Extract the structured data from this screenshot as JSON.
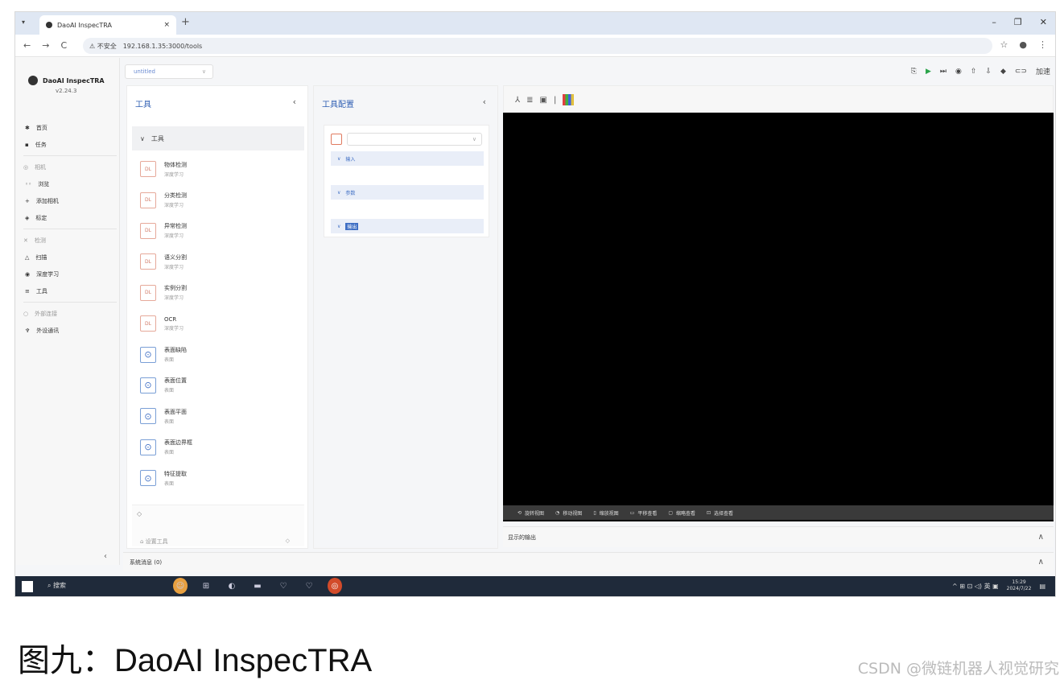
{
  "browser": {
    "tab_title": "DaoAI InspecTRA",
    "tab_close": "×",
    "new_tab": "+",
    "tabs_menu": "▾",
    "win_controls": [
      "–",
      "❐",
      "✕"
    ],
    "nav": [
      "←",
      "→",
      "C"
    ],
    "security_label": "⚠ 不安全",
    "url": "192.168.1.35:3000/tools",
    "right_icons": [
      "☆",
      "●",
      "⋮"
    ]
  },
  "app": {
    "brand": "DaoAI InspecTRA",
    "version": "v2.24.3",
    "project_select": "untitled",
    "sidebar": [
      {
        "type": "item",
        "icon": "✱",
        "label": "首页"
      },
      {
        "type": "item",
        "icon": "▪",
        "label": "任务"
      },
      {
        "type": "group",
        "icon": "◎",
        "label": "相机"
      },
      {
        "type": "item",
        "icon": "◦◦",
        "label": "浏览"
      },
      {
        "type": "item",
        "icon": "+",
        "label": "添加相机"
      },
      {
        "type": "item",
        "icon": "◈",
        "label": "标定"
      },
      {
        "type": "group",
        "icon": "✕",
        "label": "检测"
      },
      {
        "type": "item",
        "icon": "△",
        "label": "扫描"
      },
      {
        "type": "item",
        "icon": "◉",
        "label": "深度学习"
      },
      {
        "type": "item",
        "icon": "≡",
        "label": "工具"
      },
      {
        "type": "group",
        "icon": "○",
        "label": "外部连接"
      },
      {
        "type": "item",
        "icon": "♆",
        "label": "外设通讯"
      }
    ],
    "sidebar_collapse": "‹",
    "toolbar_icons": [
      "⎘",
      "▶",
      "⏭",
      "◉",
      "⇧",
      "⇩",
      "◆",
      "⊂⊃",
      "加速"
    ],
    "tools_panel": {
      "title": "工具",
      "collapse": "‹",
      "group": "工具",
      "group_chev": "∨",
      "items": [
        {
          "icon": "DL",
          "name": "物体检测",
          "sub": "深度学习",
          "kind": "dl"
        },
        {
          "icon": "DL",
          "name": "分类检测",
          "sub": "深度学习",
          "kind": "dl"
        },
        {
          "icon": "DL",
          "name": "异常检测",
          "sub": "深度学习",
          "kind": "dl"
        },
        {
          "icon": "DL",
          "name": "语义分割",
          "sub": "深度学习",
          "kind": "dl"
        },
        {
          "icon": "DL",
          "name": "实例分割",
          "sub": "深度学习",
          "kind": "dl"
        },
        {
          "icon": "DL",
          "name": "OCR",
          "sub": "深度学习",
          "kind": "dl"
        },
        {
          "icon": "⊙",
          "name": "表面缺陷",
          "sub": "表面",
          "kind": "surf"
        },
        {
          "icon": "⊙",
          "name": "表面位置",
          "sub": "表面",
          "kind": "surf"
        },
        {
          "icon": "⊙",
          "name": "表面平面",
          "sub": "表面",
          "kind": "surf"
        },
        {
          "icon": "⊙",
          "name": "表面边界框",
          "sub": "表面",
          "kind": "surf"
        },
        {
          "icon": "⊙",
          "name": "特征提取",
          "sub": "表面",
          "kind": "surf"
        }
      ],
      "footer_top": "◇",
      "footer_left": "⌂ 设置工具",
      "footer_right": "◇"
    },
    "config_panel": {
      "title": "工具配置",
      "collapse": "‹",
      "select_arrow": "∨",
      "sections": [
        "输入",
        "参数",
        "输出"
      ]
    },
    "viewer": {
      "toolbar_icons": [
        "⅄",
        "≣",
        "▣",
        "|"
      ],
      "status_items": [
        "旋转视图",
        "移动视图",
        "缩放视图",
        "平移查看",
        "缩略查看",
        "选择查看"
      ],
      "status_icons": [
        "⟲",
        "◔",
        "▯",
        "▭",
        "▢",
        "⊡"
      ],
      "output_label": "显示的输出",
      "output_chev": "∧"
    },
    "system_messages": "系统消息 (0)",
    "system_chev": "∧"
  },
  "taskbar": {
    "search": "⌕ 搜索",
    "apps": [
      "☺",
      "⊞",
      "◐",
      "▬",
      "♡",
      "♡",
      "◎"
    ],
    "tray": "^ ⊞ ⊡ ◁) 英 ▣",
    "time": "15:29",
    "date": "2024/7/22",
    "notify": "▤"
  },
  "caption": "图九：DaoAI InspecTRA",
  "watermark": "CSDN @微链机器人视觉研究"
}
